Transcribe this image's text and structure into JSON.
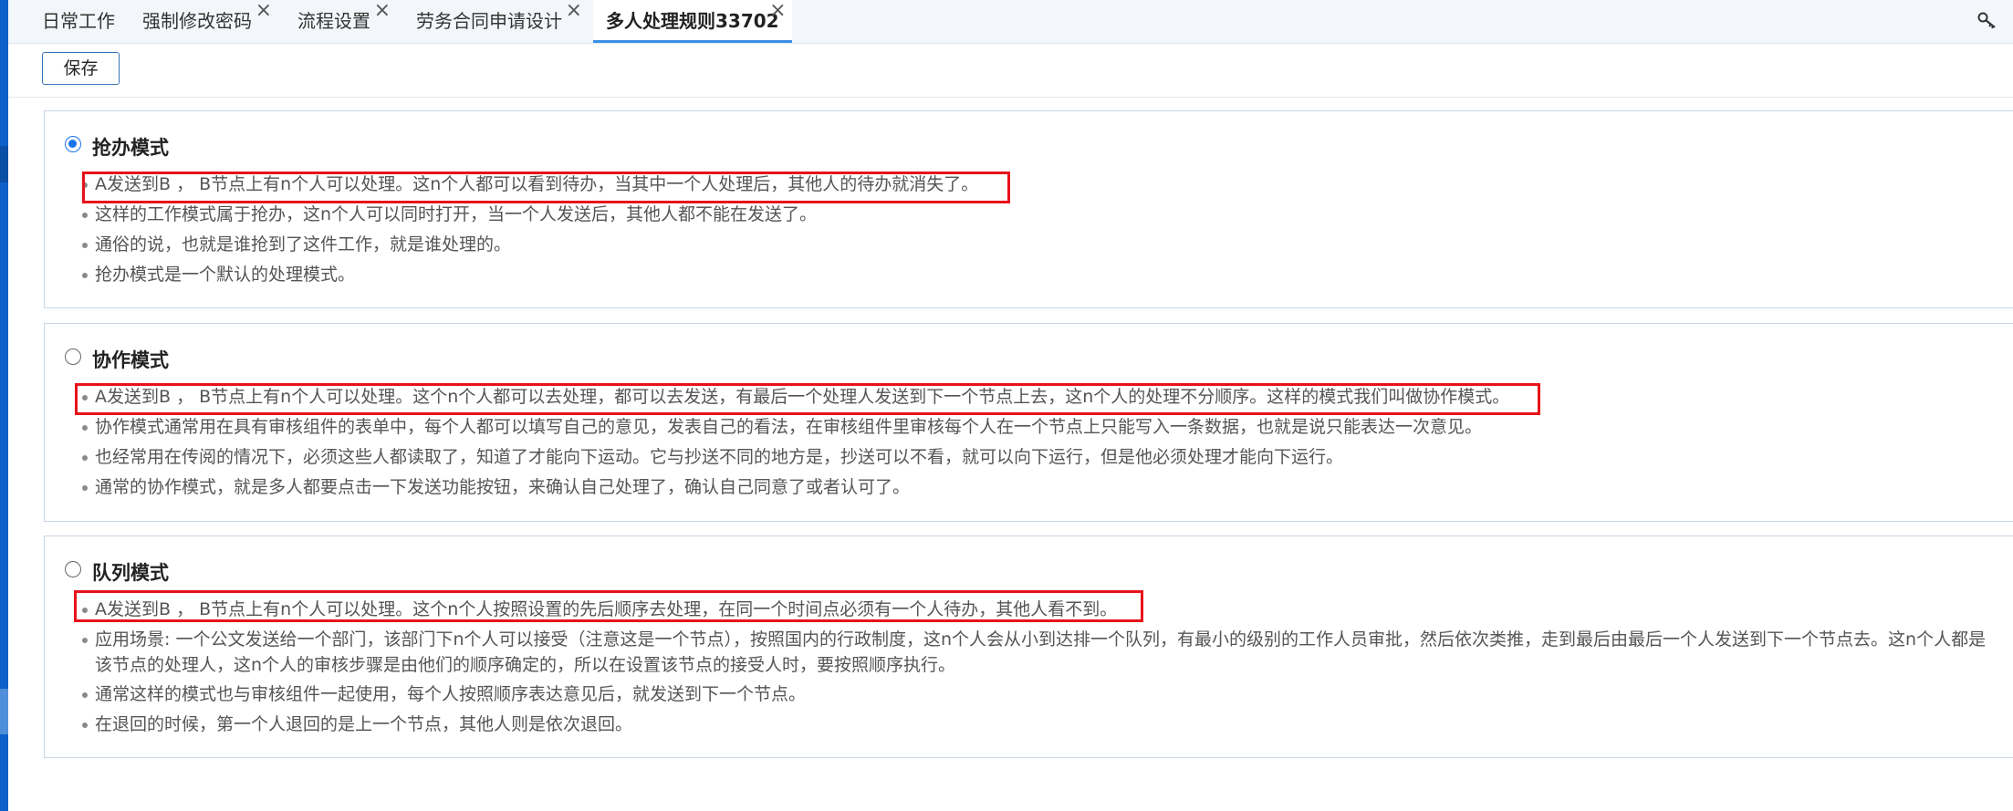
{
  "tabs": [
    {
      "label": "日常工作",
      "closable": false
    },
    {
      "label": "强制修改密码",
      "closable": true
    },
    {
      "label": "流程设置",
      "closable": true
    },
    {
      "label": "劳务合同申请设计",
      "closable": true
    },
    {
      "label": "多人处理规则33702",
      "closable": true,
      "active": true
    }
  ],
  "toolbar": {
    "save_label": "保存"
  },
  "icons": {
    "tab_close": "close-icon",
    "top_right": "key-icon"
  },
  "colors": {
    "accent": "#1a73e8",
    "highlight": "#e8121a",
    "sidebar": "#0b61c9"
  },
  "modes": [
    {
      "title": "抢办模式",
      "selected": true,
      "items": [
        "A发送到B ， B节点上有n个人可以处理。这n个人都可以看到待办，当其中一个人处理后，其他人的待办就消失了。",
        "这样的工作模式属于抢办，这n个人可以同时打开，当一个人发送后，其他人都不能在发送了。",
        "通俗的说，也就是谁抢到了这件工作，就是谁处理的。",
        "抢办模式是一个默认的处理模式。"
      ]
    },
    {
      "title": "协作模式",
      "selected": false,
      "items": [
        "A发送到B ， B节点上有n个人可以处理。这个n个人都可以去处理，都可以去发送，有最后一个处理人发送到下一个节点上去，这n个人的处理不分顺序。这样的模式我们叫做协作模式。",
        "协作模式通常用在具有审核组件的表单中，每个人都可以填写自己的意见，发表自己的看法，在审核组件里审核每个人在一个节点上只能写入一条数据，也就是说只能表达一次意见。",
        "也经常用在传阅的情况下，必须这些人都读取了，知道了才能向下运动。它与抄送不同的地方是，抄送可以不看，就可以向下运行，但是他必须处理才能向下运行。",
        "通常的协作模式，就是多人都要点击一下发送功能按钮，来确认自己处理了，确认自己同意了或者认可了。"
      ]
    },
    {
      "title": "队列模式",
      "selected": false,
      "items": [
        "A发送到B ， B节点上有n个人可以处理。这个n个人按照设置的先后顺序去处理，在同一个时间点必须有一个人待办，其他人看不到。",
        "应用场景: 一个公文发送给一个部门，该部门下n个人可以接受（注意这是一个节点），按照国内的行政制度，这n个人会从小到达排一个队列，有最小的级别的工作人员审批，然后依次类推，走到最后由最后一个人发送到下一个节点去。这n个人都是该节点的处理人，这n个人的审核步骤是由他们的顺序确定的，所以在设置该节点的接受人时，要按照顺序执行。",
        "通常这样的模式也与审核组件一起使用，每个人按照顺序表达意见后，就发送到下一个节点。",
        "在退回的时候，第一个人退回的是上一个节点，其他人则是依次退回。"
      ]
    }
  ]
}
